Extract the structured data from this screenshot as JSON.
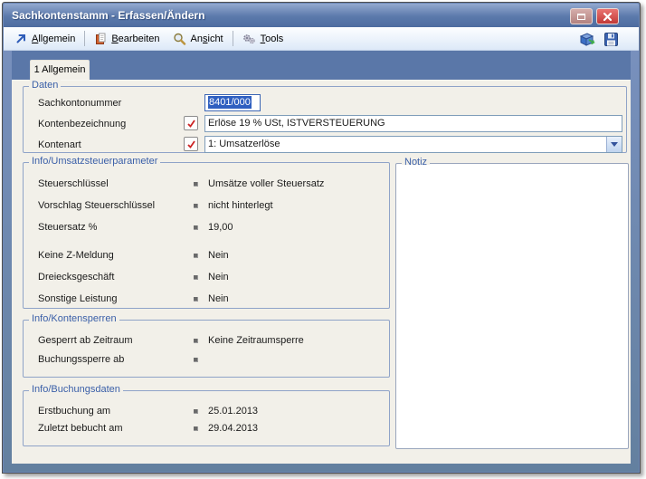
{
  "window": {
    "title": "Sachkontenstamm - Erfassen/Ändern"
  },
  "menubar": {
    "items": [
      {
        "pre": "",
        "key": "A",
        "post": "llgemein",
        "icon": "arrow-up-right-icon"
      },
      {
        "pre": "",
        "key": "B",
        "post": "earbeiten",
        "icon": "edit-document-icon"
      },
      {
        "pre": "An",
        "key": "s",
        "post": "icht",
        "icon": "magnifier-icon"
      },
      {
        "pre": "",
        "key": "T",
        "post": "ools",
        "icon": "gears-icon"
      }
    ],
    "right_icons": [
      "export-package-icon",
      "save-floppy-icon"
    ]
  },
  "tab": {
    "label": "1 Allgemein"
  },
  "daten": {
    "legend": "Daten",
    "sachkontonummer": {
      "label": "Sachkontonummer",
      "value": "8401/000"
    },
    "kontenbezeichnung": {
      "label": "Kontenbezeichnung",
      "value": "Erlöse 19 % USt, ISTVERSTEUERUNG"
    },
    "kontenart": {
      "label": "Kontenart",
      "value": "1: Umsatzerlöse"
    }
  },
  "umsatzsteuer": {
    "legend": "Info/Umsatzsteuerparameter",
    "rows": [
      {
        "label": "Steuerschlüssel",
        "value": "Umsätze voller Steuersatz"
      },
      {
        "label": "Vorschlag Steuerschlüssel",
        "value": "nicht hinterlegt"
      },
      {
        "label": "Steuersatz %",
        "value": "19,00"
      },
      {
        "label": "Keine Z-Meldung",
        "value": "Nein"
      },
      {
        "label": "Dreiecksgeschäft",
        "value": "Nein"
      },
      {
        "label": "Sonstige Leistung",
        "value": "Nein"
      }
    ]
  },
  "kontensperren": {
    "legend": "Info/Kontensperren",
    "rows": [
      {
        "label": "Gesperrt ab Zeitraum",
        "value": "Keine Zeitraumsperre"
      },
      {
        "label": "Buchungssperre ab",
        "value": ""
      }
    ]
  },
  "buchungsdaten": {
    "legend": "Info/Buchungsdaten",
    "rows": [
      {
        "label": "Erstbuchung am",
        "value": "25.01.2013"
      },
      {
        "label": "Zuletzt bebucht am",
        "value": "29.04.2013"
      }
    ]
  },
  "notiz": {
    "legend": "Notiz",
    "value": ""
  },
  "colors": {
    "titlebar": "#5b79ab",
    "frame": "#6d88b8",
    "band": "#5a77a8",
    "panel": "#f2f0e9",
    "group_label": "#3a5fa8",
    "selection": "#2f5fc0",
    "close_red": "#c23a37",
    "check_red": "#cc2222"
  }
}
